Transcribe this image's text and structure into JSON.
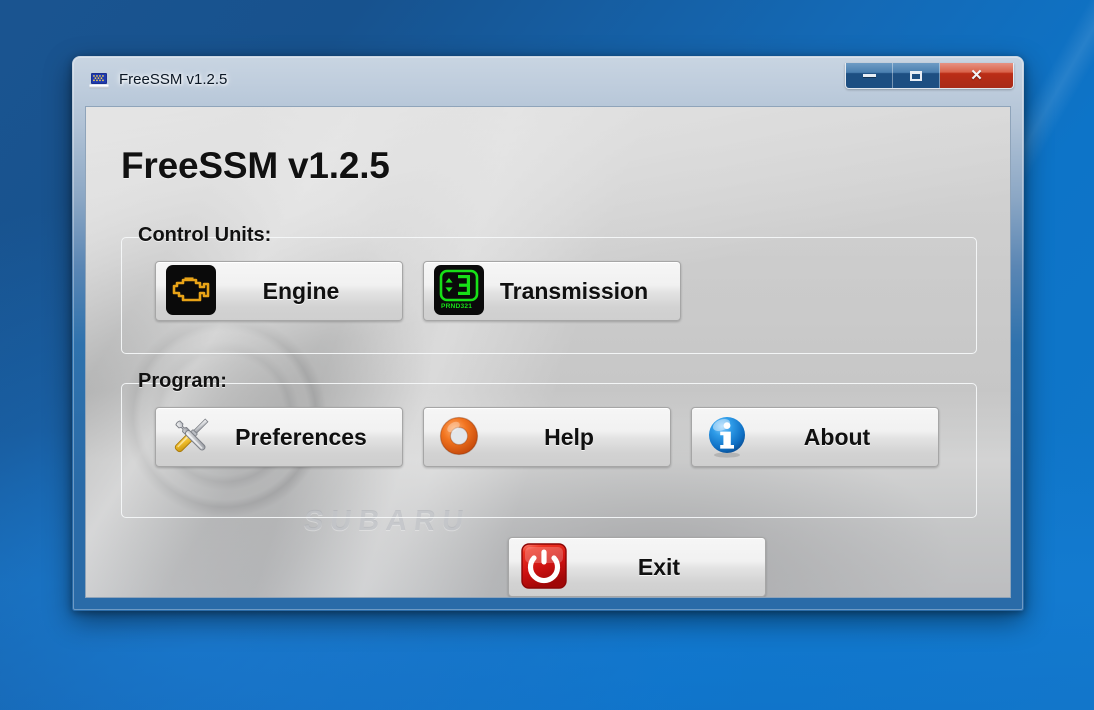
{
  "window": {
    "title": "FreeSSM v1.2.5",
    "icon": "diagnostic-device-icon",
    "caption_buttons": {
      "minimize_label": "–",
      "maximize_label": "□",
      "close_label": "✕"
    }
  },
  "client": {
    "heading": "FreeSSM v1.2.5",
    "watermark": "SUBARU"
  },
  "groups": [
    {
      "id": "control-units",
      "title": "Control Units:",
      "buttons": [
        {
          "id": "engine",
          "label": "Engine",
          "icon": "check-engine-icon"
        },
        {
          "id": "transmission",
          "label": "Transmission",
          "icon": "gear-display-icon",
          "display_value": "3",
          "display_range": "PRND321"
        }
      ]
    },
    {
      "id": "program",
      "title": "Program:",
      "buttons": [
        {
          "id": "preferences",
          "label": "Preferences",
          "icon": "tools-icon"
        },
        {
          "id": "help",
          "label": "Help",
          "icon": "life-ring-icon"
        },
        {
          "id": "about",
          "label": "About",
          "icon": "info-icon"
        }
      ]
    }
  ],
  "exit_button": {
    "label": "Exit",
    "icon": "power-icon"
  },
  "colors": {
    "titlebar_blue": "#2a6ba8",
    "close_red": "#bb2d16",
    "engine_amber": "#e8a317",
    "transmission_green": "#18e018",
    "help_orange": "#f07020",
    "about_blue": "#1a8de0",
    "exit_red": "#cc1111",
    "screwdriver_yellow": "#f2c12e"
  }
}
